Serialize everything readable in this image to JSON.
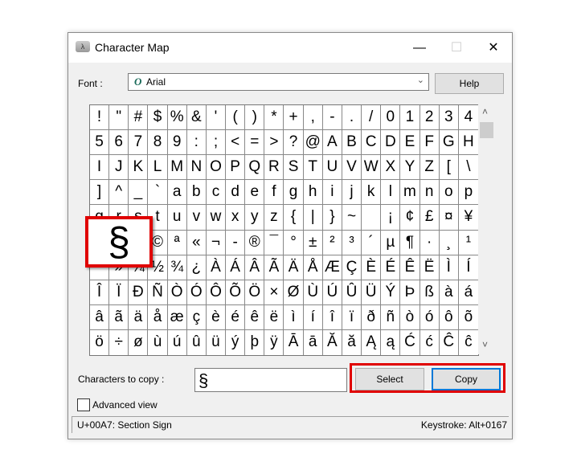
{
  "window": {
    "title": "Character Map",
    "minimize": "—",
    "maximize": "☐",
    "close": "✕"
  },
  "font": {
    "label": "Font :",
    "value": "Arial",
    "icon": "opentype-font-icon",
    "icon_glyph": "O",
    "dropdown": "⌄"
  },
  "help_label": "Help",
  "grid": {
    "rows": [
      [
        "!",
        "\"",
        "#",
        "$",
        "%",
        "&",
        "'",
        "(",
        ")",
        "*",
        "+",
        ",",
        "-",
        ".",
        "/",
        "0",
        "1",
        "2",
        "3",
        "4"
      ],
      [
        "5",
        "6",
        "7",
        "8",
        "9",
        ":",
        ";",
        "<",
        "=",
        ">",
        "?",
        "@",
        "A",
        "B",
        "C",
        "D",
        "E",
        "F",
        "G",
        "H"
      ],
      [
        "I",
        "J",
        "K",
        "L",
        "M",
        "N",
        "O",
        "P",
        "Q",
        "R",
        "S",
        "T",
        "U",
        "V",
        "W",
        "X",
        "Y",
        "Z",
        "[",
        "\\"
      ],
      [
        "]",
        "^",
        "_",
        "`",
        "a",
        "b",
        "c",
        "d",
        "e",
        "f",
        "g",
        "h",
        "i",
        "j",
        "k",
        "l",
        "m",
        "n",
        "o",
        "p"
      ],
      [
        "q",
        "r",
        "s",
        "t",
        "u",
        "v",
        "w",
        "x",
        "y",
        "z",
        "{",
        "|",
        "}",
        "~",
        " ",
        "¡",
        "¢",
        "£",
        "¤",
        "¥"
      ],
      [
        "¦",
        "§",
        "¨",
        "©",
        "ª",
        "«",
        "¬",
        "-",
        "®",
        "¯",
        "°",
        "±",
        "²",
        "³",
        "´",
        "µ",
        "¶",
        "·",
        "¸",
        "¹"
      ],
      [
        "º",
        "»",
        "¼",
        "½",
        "¾",
        "¿",
        "À",
        "Á",
        "Â",
        "Ã",
        "Ä",
        "Å",
        "Æ",
        "Ç",
        "È",
        "É",
        "Ê",
        "Ë",
        "Ì",
        "Í"
      ],
      [
        "Î",
        "Ï",
        "Ð",
        "Ñ",
        "Ò",
        "Ó",
        "Ô",
        "Õ",
        "Ö",
        "×",
        "Ø",
        "Ù",
        "Ú",
        "Û",
        "Ü",
        "Ý",
        "Þ",
        "ß",
        "à",
        "á"
      ],
      [
        "â",
        "ã",
        "ä",
        "å",
        "æ",
        "ç",
        "è",
        "é",
        "ê",
        "ë",
        "ì",
        "í",
        "î",
        "ï",
        "ð",
        "ñ",
        "ò",
        "ó",
        "ô",
        "õ"
      ],
      [
        "ö",
        "÷",
        "ø",
        "ù",
        "ú",
        "û",
        "ü",
        "ý",
        "þ",
        "ÿ",
        "Ā",
        "ā",
        "Ă",
        "ă",
        "Ą",
        "ą",
        "Ć",
        "ć",
        "Ĉ",
        "ĉ"
      ]
    ],
    "selected": "§",
    "scroll_up": "˄",
    "scroll_down": "˅"
  },
  "copy": {
    "label": "Characters to copy :",
    "value": "§",
    "select_label": "Select",
    "copy_label": "Copy"
  },
  "advanced": {
    "label": "Advanced view",
    "checked": false
  },
  "status": {
    "left": "U+00A7: Section Sign",
    "right": "Keystroke: Alt+0167"
  },
  "colors": {
    "highlight": "#e00000",
    "focus": "#0078d7"
  }
}
